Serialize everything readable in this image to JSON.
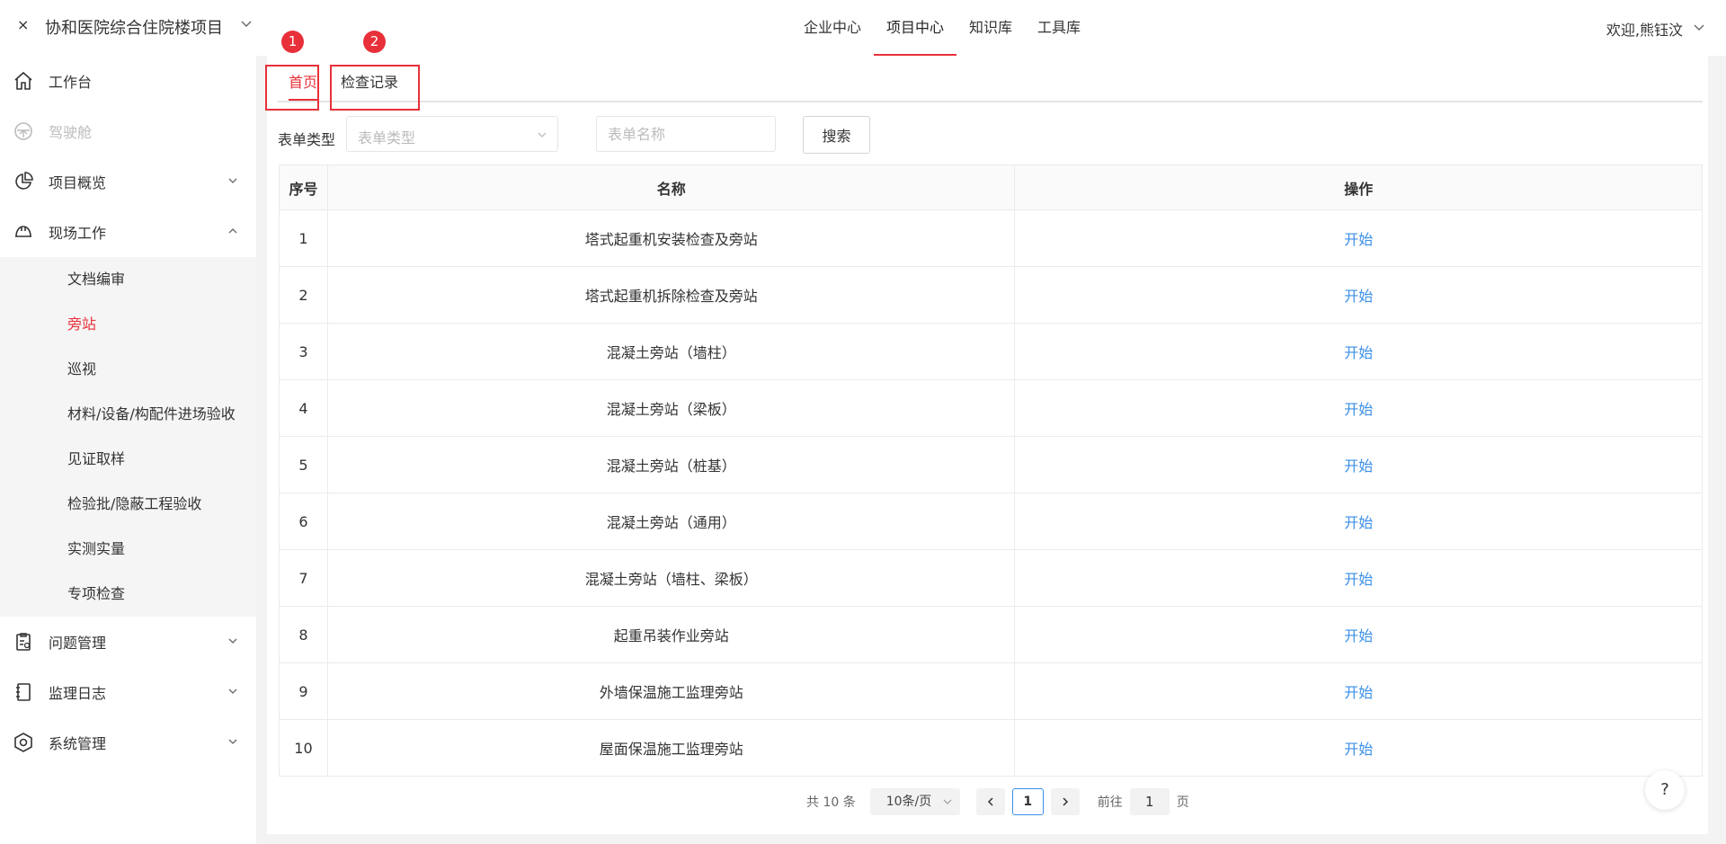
{
  "header": {
    "close_glyph": "×",
    "project_name": "协和医院综合住院楼项目",
    "nav": [
      "企业中心",
      "项目中心",
      "知识库",
      "工具库"
    ],
    "active_nav": "项目中心",
    "welcome": "欢迎,熊钰汶"
  },
  "sidebar": {
    "items": [
      {
        "label": "工作台",
        "icon": "home-icon"
      },
      {
        "label": "驾驶舱",
        "icon": "dashboard-icon"
      },
      {
        "label": "项目概览",
        "icon": "pie-chart-icon"
      },
      {
        "label": "现场工作",
        "icon": "helmet-icon"
      },
      {
        "label": "问题管理",
        "icon": "clipboard-icon"
      },
      {
        "label": "监理日志",
        "icon": "notebook-icon"
      },
      {
        "label": "系统管理",
        "icon": "settings-hex-icon"
      }
    ],
    "submenu": [
      "文档编审",
      "旁站",
      "巡视",
      "材料/设备/构配件进场验收",
      "见证取样",
      "检验批/隐蔽工程验收",
      "实测实量",
      "专项检查"
    ],
    "active_sub": "旁站"
  },
  "tabs": {
    "home": "首页",
    "records": "检查记录",
    "badge1": "1",
    "badge2": "2"
  },
  "filter": {
    "type_label": "表单类型",
    "type_placeholder": "表单类型",
    "name_placeholder": "表单名称",
    "search_button": "搜索"
  },
  "table": {
    "headers": {
      "index": "序号",
      "name": "名称",
      "action": "操作"
    },
    "action_label": "开始",
    "rows": [
      {
        "index": "1",
        "name": "塔式起重机安装检查及旁站"
      },
      {
        "index": "2",
        "name": "塔式起重机拆除检查及旁站"
      },
      {
        "index": "3",
        "name": "混凝土旁站（墙柱）"
      },
      {
        "index": "4",
        "name": "混凝土旁站（梁板）"
      },
      {
        "index": "5",
        "name": "混凝土旁站（桩基）"
      },
      {
        "index": "6",
        "name": "混凝土旁站（通用）"
      },
      {
        "index": "7",
        "name": "混凝土旁站（墙柱、梁板）"
      },
      {
        "index": "8",
        "name": "起重吊装作业旁站"
      },
      {
        "index": "9",
        "name": "外墙保温施工监理旁站"
      },
      {
        "index": "10",
        "name": "屋面保温施工监理旁站"
      }
    ]
  },
  "pagination": {
    "total": "共 10 条",
    "page_size": "10条/页",
    "current_page": "1",
    "goto_label": "前往",
    "goto_value": "1",
    "page_suffix": "页"
  },
  "help": "?",
  "colors": {
    "accent": "#e8303a",
    "link": "#3b8fe8"
  }
}
